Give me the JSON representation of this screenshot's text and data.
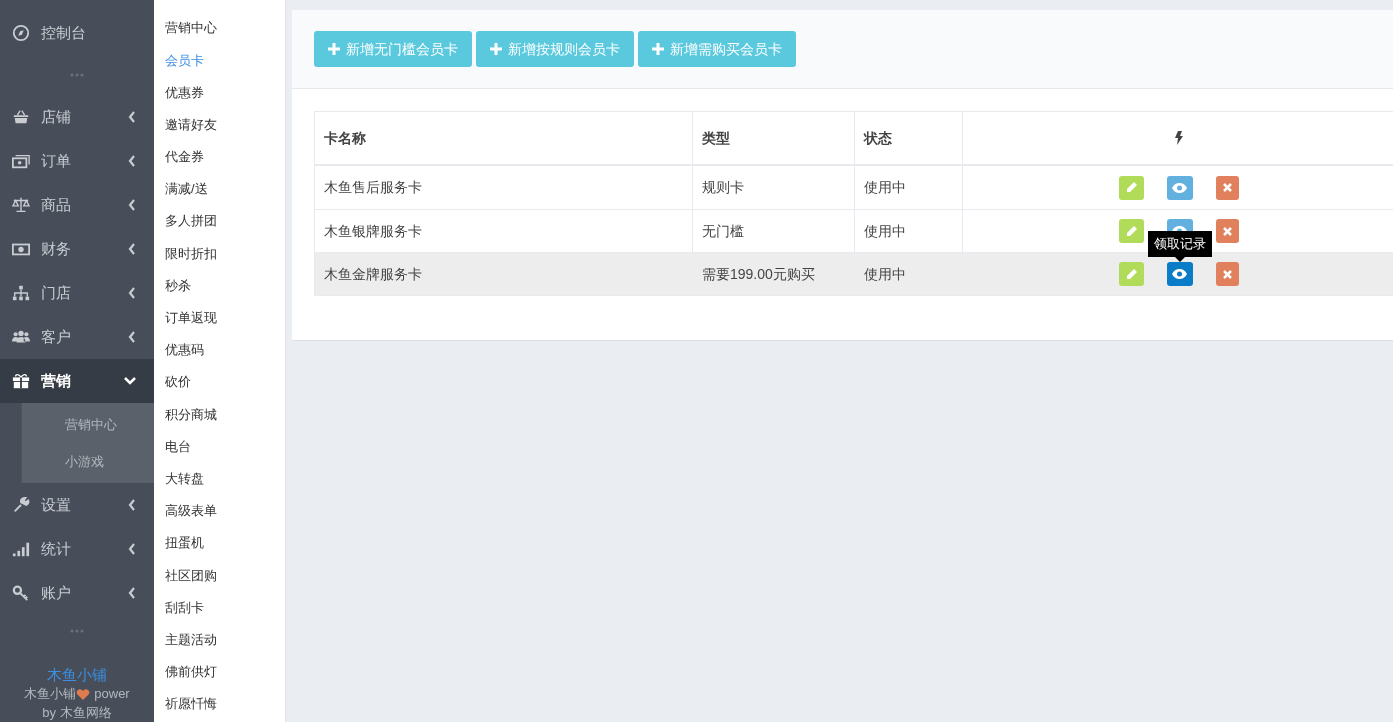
{
  "sidebar": {
    "items": [
      {
        "label": "控制台",
        "kind": "link"
      },
      {
        "label": "店铺",
        "kind": "menu",
        "expanded": false
      },
      {
        "label": "订单",
        "kind": "menu",
        "expanded": false
      },
      {
        "label": "商品",
        "kind": "menu",
        "expanded": false
      },
      {
        "label": "财务",
        "kind": "menu",
        "expanded": false
      },
      {
        "label": "门店",
        "kind": "menu",
        "expanded": false
      },
      {
        "label": "客户",
        "kind": "menu",
        "expanded": false
      },
      {
        "label": "营销",
        "kind": "menu",
        "expanded": true,
        "children": [
          {
            "label": "营销中心"
          },
          {
            "label": "小游戏"
          }
        ]
      },
      {
        "label": "设置",
        "kind": "menu",
        "expanded": false
      },
      {
        "label": "统计",
        "kind": "menu",
        "expanded": false
      },
      {
        "label": "账户",
        "kind": "menu",
        "expanded": false
      }
    ],
    "footer": {
      "brand": "木鱼小铺",
      "power_prefix": "木鱼小铺",
      "power_suffix": "power",
      "by": "by 木鱼网络"
    }
  },
  "submenu": {
    "items": [
      {
        "label": "营销中心",
        "selected": false
      },
      {
        "label": "会员卡",
        "selected": true
      },
      {
        "label": "优惠券",
        "selected": false
      },
      {
        "label": "邀请好友",
        "selected": false
      },
      {
        "label": "代金券",
        "selected": false
      },
      {
        "label": "满减/送",
        "selected": false
      },
      {
        "label": "多人拼团",
        "selected": false
      },
      {
        "label": "限时折扣",
        "selected": false
      },
      {
        "label": "秒杀",
        "selected": false
      },
      {
        "label": "订单返现",
        "selected": false
      },
      {
        "label": "优惠码",
        "selected": false
      },
      {
        "label": "砍价",
        "selected": false
      },
      {
        "label": "积分商城",
        "selected": false
      },
      {
        "label": "电台",
        "selected": false
      },
      {
        "label": "大转盘",
        "selected": false
      },
      {
        "label": "高级表单",
        "selected": false
      },
      {
        "label": "扭蛋机",
        "selected": false
      },
      {
        "label": "社区团购",
        "selected": false
      },
      {
        "label": "刮刮卡",
        "selected": false
      },
      {
        "label": "主题活动",
        "selected": false
      },
      {
        "label": "佛前供灯",
        "selected": false
      },
      {
        "label": "祈愿忏悔",
        "selected": false
      }
    ]
  },
  "toolbar": {
    "buttons": [
      "新增无门槛会员卡",
      "新增按规则会员卡",
      "新增需购买会员卡"
    ]
  },
  "table": {
    "columns": [
      "卡名称",
      "类型",
      "状态"
    ],
    "rows": [
      {
        "name": "木鱼售后服务卡",
        "type": "规则卡",
        "status": "使用中",
        "hovered": false,
        "view_hovered": false
      },
      {
        "name": "木鱼银牌服务卡",
        "type": "无门槛",
        "status": "使用中",
        "hovered": false,
        "view_hovered": false
      },
      {
        "name": "木鱼金牌服务卡",
        "type": "需要199.00元购买",
        "status": "使用中",
        "hovered": true,
        "view_hovered": true,
        "tooltip": "领取记录"
      }
    ]
  }
}
